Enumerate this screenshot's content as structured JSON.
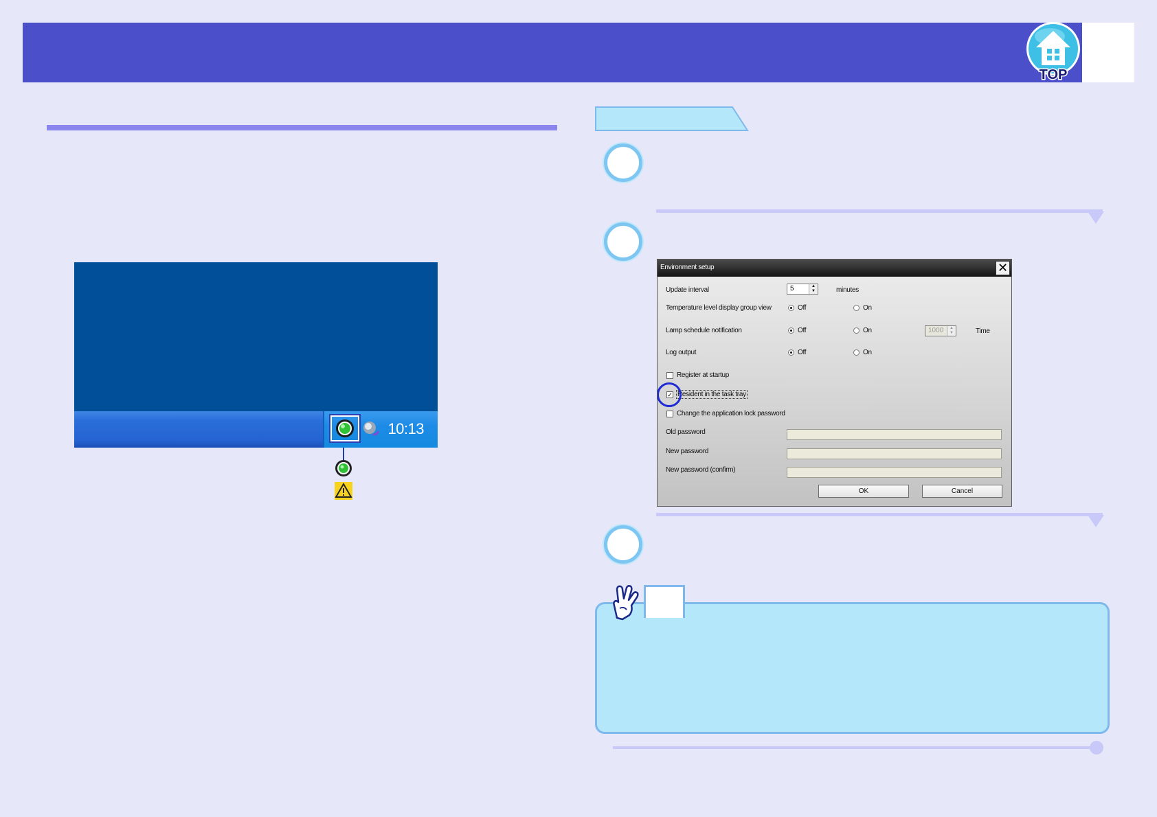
{
  "header": {
    "top_logo_label": "TOP"
  },
  "taskbar": {
    "clock": "10:13"
  },
  "dialog": {
    "title": "Environment setup",
    "rows": {
      "update_interval": {
        "label": "Update interval",
        "value": "5",
        "unit": "minutes"
      },
      "temperature": {
        "label": "Temperature level display group view",
        "off": "Off",
        "on": "On"
      },
      "lamp": {
        "label": "Lamp schedule notification",
        "off": "Off",
        "on": "On",
        "value": "1000",
        "unit": "Time"
      },
      "log": {
        "label": "Log output",
        "off": "Off",
        "on": "On"
      }
    },
    "checkboxes": {
      "register_startup": {
        "label": "Register at startup",
        "checked": false
      },
      "resident_tray": {
        "label": "Resident in the task tray",
        "checked": true
      },
      "change_password": {
        "label": "Change the application lock password",
        "checked": false
      }
    },
    "fields": {
      "old_password": {
        "label": "Old password"
      },
      "new_password": {
        "label": "New password"
      },
      "confirm_password": {
        "label": "New password (confirm)"
      }
    },
    "buttons": {
      "ok": "OK",
      "cancel": "Cancel"
    }
  },
  "colors": {
    "header": "#4b4fc9",
    "page_background": "#e6e8fa",
    "note_background": "#b3e7f9",
    "note_border": "#7fb9ec",
    "desktop": "#004f98"
  }
}
